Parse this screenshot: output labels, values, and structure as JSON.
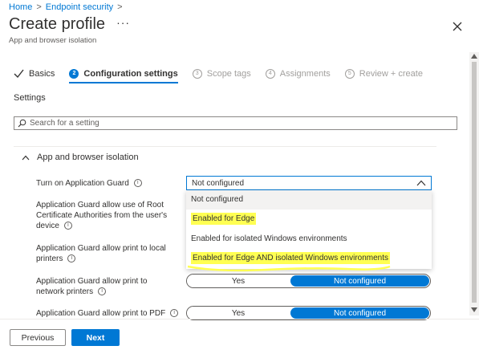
{
  "breadcrumb": {
    "home": "Home",
    "section": "Endpoint security"
  },
  "header": {
    "title": "Create profile",
    "more": "···",
    "subtitle": "App and browser isolation"
  },
  "steps": [
    {
      "label": "Basics",
      "state": "done"
    },
    {
      "number": "2",
      "label": "Configuration settings",
      "state": "active"
    },
    {
      "number": "3",
      "label": "Scope tags",
      "state": "disabled"
    },
    {
      "number": "4",
      "label": "Assignments",
      "state": "disabled"
    },
    {
      "number": "5",
      "label": "Review + create",
      "state": "disabled"
    }
  ],
  "settings_label": "Settings",
  "search": {
    "placeholder": "Search for a setting",
    "icon": "search-icon"
  },
  "group": {
    "title": "App and browser isolation",
    "expanded": true
  },
  "settings": [
    {
      "label": "Turn on Application Guard",
      "control": "dropdown",
      "value": "Not configured"
    },
    {
      "label": "Application Guard allow use of Root Certificate Authorities from the user's device"
    },
    {
      "label": "Application Guard allow print to local printers"
    },
    {
      "label": "Application Guard allow print to network printers",
      "control": "toggle",
      "options": [
        "Yes",
        "Not configured"
      ],
      "selected": "Not configured"
    },
    {
      "label": "Application Guard allow print to PDF",
      "control": "toggle",
      "options": [
        "Yes",
        "Not configured"
      ],
      "selected": "Not configured"
    }
  ],
  "dropdown_options": [
    "Not configured",
    "Enabled for Edge",
    "Enabled for isolated Windows environments",
    "Enabled for Edge AND isolated Windows environments"
  ],
  "footer": {
    "previous": "Previous",
    "next": "Next"
  },
  "colors": {
    "accent": "#0078d4",
    "highlight": "#ffff52",
    "text": "#323130",
    "muted": "#605e5c"
  }
}
